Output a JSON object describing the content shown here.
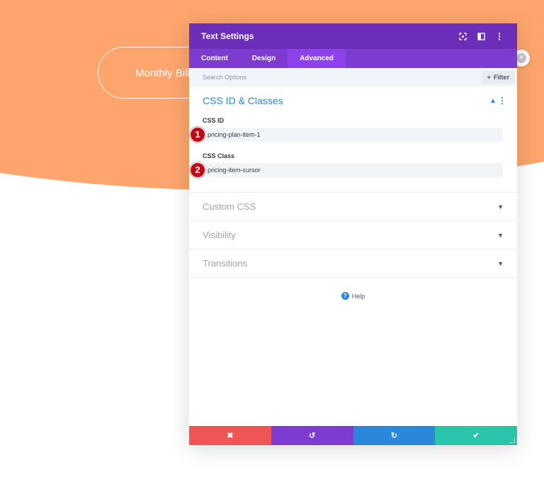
{
  "background": {
    "pill_label": "Monthly Billing",
    "accent": "#fda56d"
  },
  "modal": {
    "title": "Text Settings",
    "header_icons": [
      "focus-icon",
      "split-view-icon",
      "more-options-icon"
    ],
    "tabs": [
      {
        "label": "Content",
        "active": false
      },
      {
        "label": "Design",
        "active": false
      },
      {
        "label": "Advanced",
        "active": true
      }
    ],
    "search": {
      "placeholder": "Search Options",
      "filter_label": "Filter"
    },
    "css_section": {
      "title": "CSS ID & Classes",
      "fields": [
        {
          "label": "CSS ID",
          "value": "pricing-plan-item-1",
          "marker": "1"
        },
        {
          "label": "CSS Class",
          "value": "pricing-item-cursor",
          "marker": "2"
        }
      ]
    },
    "collapsed_sections": [
      "Custom CSS",
      "Visibility",
      "Transitions"
    ],
    "help_label": "Help",
    "footer": {
      "discard": "✖",
      "undo": "↺",
      "redo": "↻",
      "save": "✔"
    }
  },
  "colors": {
    "header": "#6c2eb9",
    "tabs": "#7d3bcf",
    "active_tab": "#8f42ec",
    "section_title": "#2b87da",
    "discard": "#ef5555",
    "undo": "#7e3bd0",
    "redo": "#2b87da",
    "save": "#29c4a9",
    "marker": "#c10916"
  }
}
